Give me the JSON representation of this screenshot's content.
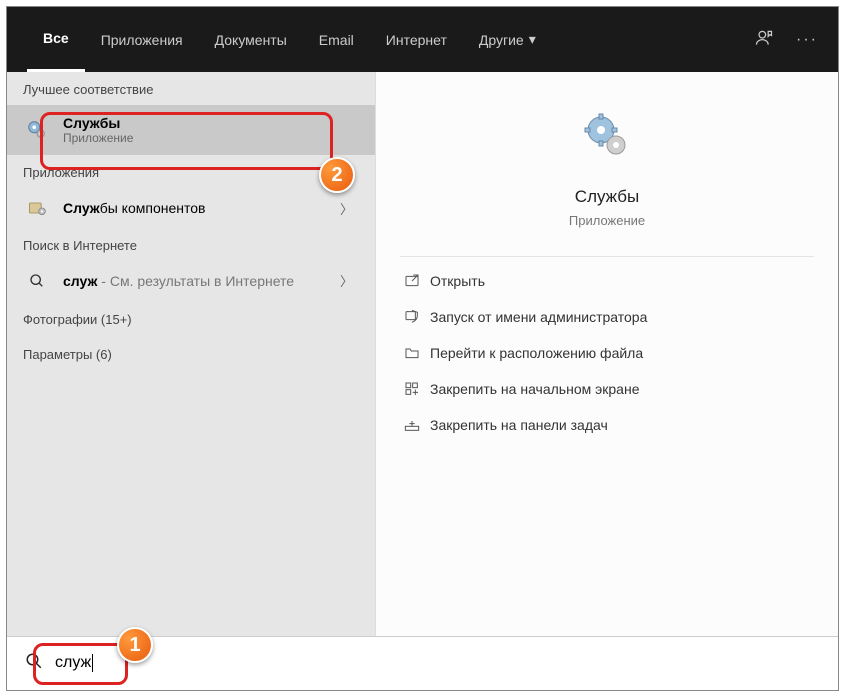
{
  "tabs": {
    "all": "Все",
    "apps": "Приложения",
    "documents": "Документы",
    "email": "Email",
    "internet": "Интернет",
    "other": "Другие"
  },
  "left": {
    "bestMatchLabel": "Лучшее соответствие",
    "bestMatch": {
      "title": "Службы",
      "sub": "Приложение"
    },
    "appsLabel": "Приложения",
    "appResult": {
      "title": "Службы компонентов"
    },
    "webLabel": "Поиск в Интернете",
    "webResult": {
      "prefix": "служ",
      "suffix": " - См. результаты в Интернете"
    },
    "photosLabel": "Фотографии (15+)",
    "paramsLabel": "Параметры (6)"
  },
  "preview": {
    "title": "Службы",
    "sub": "Приложение"
  },
  "actions": {
    "open": "Открыть",
    "runAdmin": "Запуск от имени администратора",
    "openLocation": "Перейти к расположению файла",
    "pinStart": "Закрепить на начальном экране",
    "pinTaskbar": "Закрепить на панели задач"
  },
  "search": {
    "value": "служ"
  },
  "badges": {
    "one": "1",
    "two": "2"
  }
}
